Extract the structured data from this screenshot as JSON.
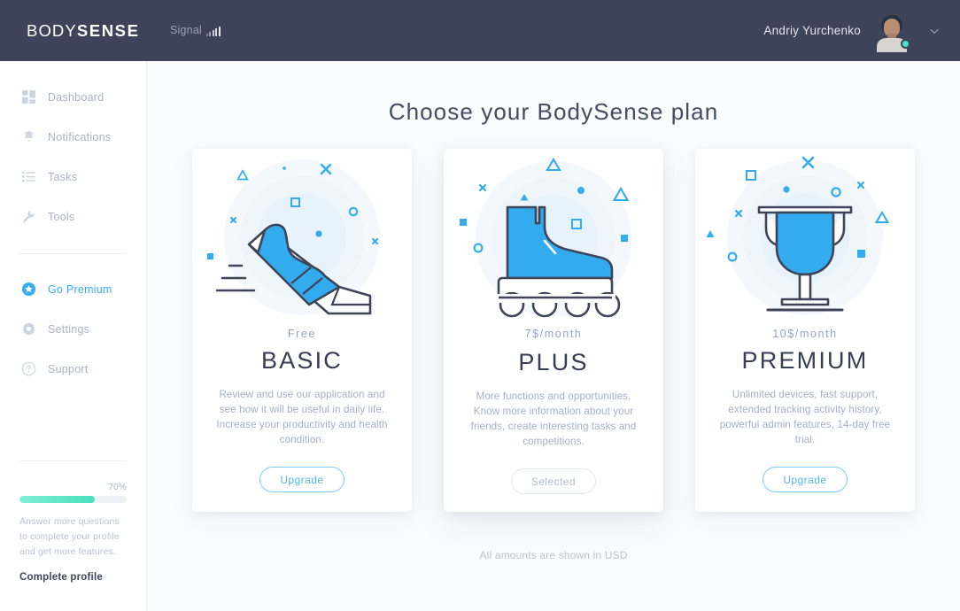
{
  "header": {
    "logo_thin": "BODY",
    "logo_bold": "SENSE",
    "signal_label": "Signal",
    "signal_icon": "signal-bars-icon",
    "user_name": "Andriy Yurchenko",
    "avatar_icon": "avatar",
    "status": "online",
    "chevron_icon": "chevron-down-icon"
  },
  "sidebar": {
    "items": [
      {
        "label": "Dashboard",
        "icon": "grid-icon",
        "active": false
      },
      {
        "label": "Notifications",
        "icon": "bell-icon",
        "active": false
      },
      {
        "label": "Tasks",
        "icon": "list-icon",
        "active": false
      },
      {
        "label": "Tools",
        "icon": "wrench-icon",
        "active": false
      },
      {
        "label": "Go Premium",
        "icon": "star-badge-icon",
        "active": true
      },
      {
        "label": "Settings",
        "icon": "gear-icon",
        "active": false
      },
      {
        "label": "Support",
        "icon": "help-circle-icon",
        "active": false
      }
    ],
    "progress": {
      "percent_label": "70%",
      "percent_value": 70,
      "hint": "Answer more questions to complete your profile and get more features.",
      "link": "Complete profile"
    }
  },
  "main": {
    "title": "Choose your BodySense plan",
    "footnote": "All amounts are shown in USD",
    "plans": [
      {
        "price": "Free",
        "name": "BASIC",
        "description": "Review and use our application and see how it will be useful in daily life. Increase your productivity and health condition.",
        "button": "Upgrade",
        "button_state": "available",
        "illustration": "running-shoe-icon",
        "featured": false
      },
      {
        "price": "7$/month",
        "name": "PLUS",
        "description": "More functions and opportunities. Know more information about your friends, create interesting tasks and competitions.",
        "button": "Selected",
        "button_state": "selected",
        "illustration": "roller-skate-icon",
        "featured": true
      },
      {
        "price": "10$/month",
        "name": "PREMIUM",
        "description": "Unlimited devices, fast support, extended tracking activity history, powerful admin features, 14-day free trial.",
        "button": "Upgrade",
        "button_state": "available",
        "illustration": "trophy-icon",
        "featured": false
      }
    ]
  },
  "colors": {
    "header_bg": "#3d4359",
    "accent_blue": "#35aef5",
    "illustration_blue": "#32ACEF",
    "outline_dark": "#3f4559",
    "progress_teal": "#4ae0bd",
    "page_bg": "#fafbfc"
  }
}
